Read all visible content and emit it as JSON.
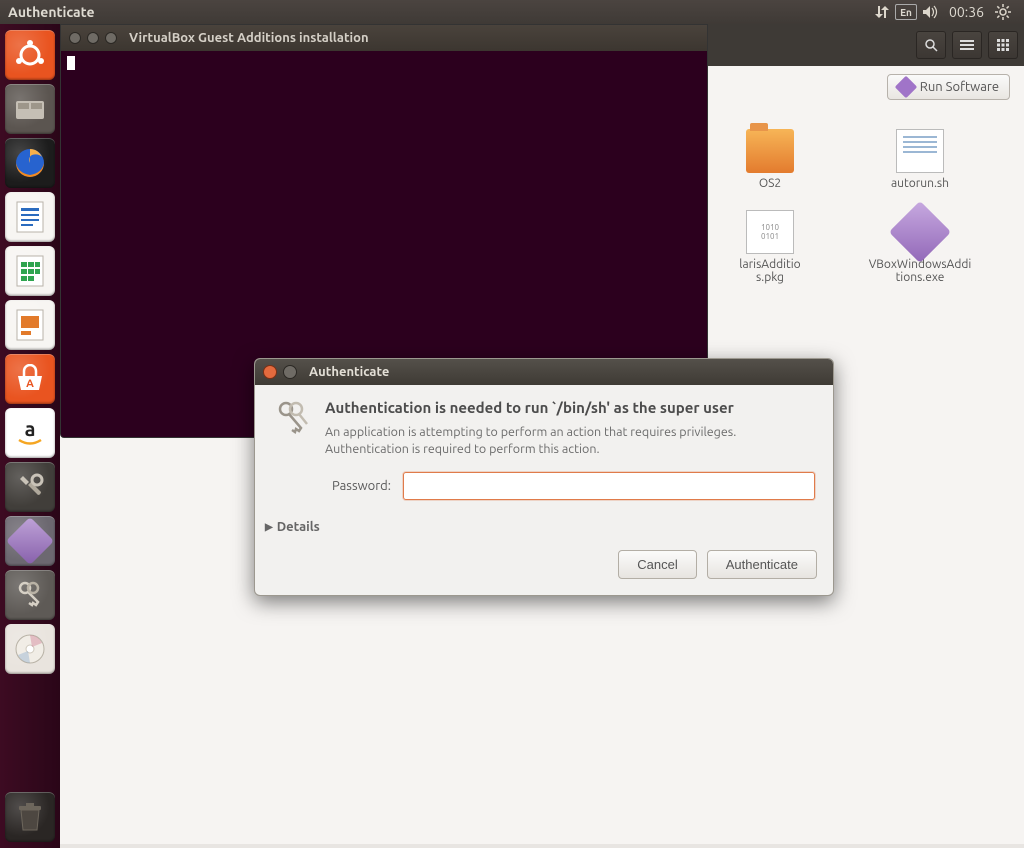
{
  "menubar": {
    "title": "Authenticate",
    "lang": "En",
    "clock": "00:36"
  },
  "launcher": {
    "items": [
      {
        "name": "dash",
        "bg": "#e95420"
      },
      {
        "name": "files",
        "bg": "#5b5550"
      },
      {
        "name": "firefox",
        "bg": "#1c1c1c"
      },
      {
        "name": "writer",
        "bg": "#f7f5f2"
      },
      {
        "name": "calc",
        "bg": "#f7f5f2"
      },
      {
        "name": "impress",
        "bg": "#f7f5f2"
      },
      {
        "name": "software",
        "bg": "#e95420"
      },
      {
        "name": "amazon",
        "bg": "#ffffff"
      },
      {
        "name": "settings",
        "bg": "#413e3a"
      },
      {
        "name": "vbox",
        "bg": "#6c6870"
      },
      {
        "name": "keys",
        "bg": "#5e5a56"
      },
      {
        "name": "disc",
        "bg": "#e9e4de"
      }
    ],
    "trash": {
      "name": "trash",
      "bg": "#2a2624"
    }
  },
  "files": {
    "run_btn": "Run Software",
    "items": [
      {
        "label": "OS2",
        "icon": "folder"
      },
      {
        "label": "autorun.sh",
        "icon": "txt"
      },
      {
        "label": "larisAdditio\ns.pkg",
        "icon": "pkg"
      },
      {
        "label": "VBoxWindowsAddi\ntions.exe",
        "icon": "dia"
      }
    ]
  },
  "terminal": {
    "title": "VirtualBox Guest Additions installation"
  },
  "dialog": {
    "title": "Authenticate",
    "heading": "Authentication is needed to run `/bin/sh' as the super user",
    "body": "An application is attempting to perform an action that requires privileges. Authentication is required to perform this action.",
    "password_label": "Password:",
    "password_value": "",
    "details": "Details",
    "cancel": "Cancel",
    "authenticate": "Authenticate"
  }
}
